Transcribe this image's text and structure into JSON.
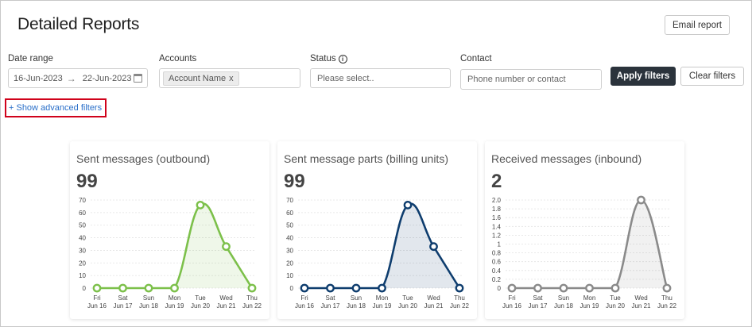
{
  "header": {
    "title": "Detailed Reports",
    "email_label": "Email report"
  },
  "filters": {
    "date_label": "Date range",
    "date_from": "16-Jun-2023",
    "date_to": "22-Jun-2023",
    "accounts_label": "Accounts",
    "accounts_chip": "Account Name",
    "accounts_chip_remove": "x",
    "status_label": "Status",
    "status_placeholder": "Please select..",
    "contact_label": "Contact",
    "contact_placeholder": "Phone number or contact",
    "apply_label": "Apply filters",
    "clear_label": "Clear filters",
    "advanced_link": "+ Show advanced filters"
  },
  "chart_data": [
    {
      "type": "area",
      "title": "Sent messages (outbound)",
      "total": "99",
      "color": "#7cc04a",
      "categories": [
        "Fri Jun 16",
        "Sat Jun 17",
        "Sun Jun 18",
        "Mon Jun 19",
        "Tue Jun 20",
        "Wed Jun 21",
        "Thu Jun 22"
      ],
      "cat_top": [
        "Fri",
        "Sat",
        "Sun",
        "Mon",
        "Tue",
        "Wed",
        "Thu"
      ],
      "cat_bottom": [
        "Jun 16",
        "Jun 17",
        "Jun 18",
        "Jun 19",
        "Jun 20",
        "Jun 21",
        "Jun 22"
      ],
      "values": [
        0,
        0,
        0,
        0,
        66,
        33,
        0
      ],
      "yticks": [
        "0",
        "10",
        "20",
        "30",
        "40",
        "50",
        "60",
        "70"
      ],
      "ylim": [
        0,
        70
      ]
    },
    {
      "type": "area",
      "title": "Sent message parts (billing units)",
      "total": "99",
      "color": "#0e3d6e",
      "categories": [
        "Fri Jun 16",
        "Sat Jun 17",
        "Sun Jun 18",
        "Mon Jun 19",
        "Tue Jun 20",
        "Wed Jun 21",
        "Thu Jun 22"
      ],
      "cat_top": [
        "Fri",
        "Sat",
        "Sun",
        "Mon",
        "Tue",
        "Wed",
        "Thu"
      ],
      "cat_bottom": [
        "Jun 16",
        "Jun 17",
        "Jun 18",
        "Jun 19",
        "Jun 20",
        "Jun 21",
        "Jun 22"
      ],
      "values": [
        0,
        0,
        0,
        0,
        66,
        33,
        0
      ],
      "yticks": [
        "0",
        "10",
        "20",
        "30",
        "40",
        "50",
        "60",
        "70"
      ],
      "ylim": [
        0,
        70
      ]
    },
    {
      "type": "area",
      "title": "Received messages (inbound)",
      "total": "2",
      "color": "#8a8a8a",
      "categories": [
        "Fri Jun 16",
        "Sat Jun 17",
        "Sun Jun 18",
        "Mon Jun 19",
        "Tue Jun 20",
        "Wed Jun 21",
        "Thu Jun 22"
      ],
      "cat_top": [
        "Fri",
        "Sat",
        "Sun",
        "Mon",
        "Tue",
        "Wed",
        "Thu"
      ],
      "cat_bottom": [
        "Jun 16",
        "Jun 17",
        "Jun 18",
        "Jun 19",
        "Jun 20",
        "Jun 21",
        "Jun 22"
      ],
      "values": [
        0,
        0,
        0,
        0,
        0,
        2,
        0
      ],
      "yticks": [
        "0",
        "0.2",
        "0.4",
        "0.6",
        "0.8",
        "1",
        "1.2",
        "1.4",
        "1.6",
        "1.8",
        "2.0"
      ],
      "ylim": [
        0,
        2
      ]
    }
  ]
}
